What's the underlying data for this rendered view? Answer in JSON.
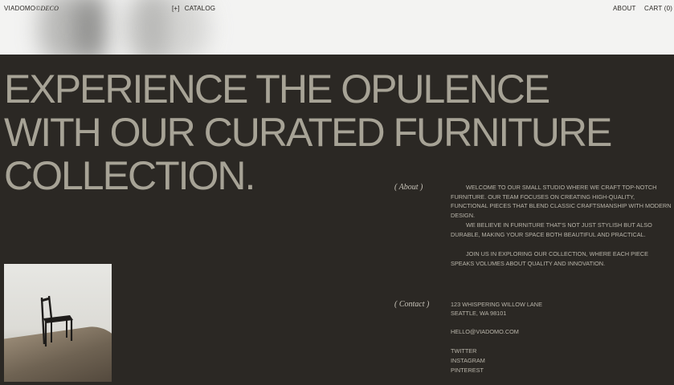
{
  "nav": {
    "logo_main": "VIADOMO",
    "logo_accent": "©DECO",
    "catalog_icon": "[+]",
    "catalog_label": "CATALOG",
    "about_label": "ABOUT",
    "cart_label": "CART (0)"
  },
  "hero": {
    "line1": "EXPERIENCE THE OPULENCE",
    "line2": "WITH OUR CURATED FURNITURE",
    "line3": "COLLECTION."
  },
  "about": {
    "label": "( About )",
    "paragraphs": [
      "WELCOME TO OUR SMALL STUDIO WHERE WE CRAFT TOP-NOTCH FURNITURE. OUR TEAM FOCUSES ON CREATING HIGH-QUALITY, FUNCTIONAL PIECES THAT BLEND CLASSIC CRAFTSMANSHIP WITH MODERN DESIGN.",
      "WE BELIEVE IN FURNITURE THAT'S NOT JUST STYLISH BUT ALSO DURABLE, MAKING YOUR SPACE BOTH BEAUTIFUL AND PRACTICAL.",
      "JOIN US IN EXPLORING OUR COLLECTION, WHERE EACH PIECE SPEAKS VOLUMES ABOUT QUALITY AND INNOVATION."
    ]
  },
  "contact": {
    "label": "( Contact )",
    "address1": "123 WHISPERING WILLOW LANE",
    "address2": "SEATTLE, WA 98101",
    "email": "HELLO@VIADOMO.COM",
    "socials": [
      "TWITTER",
      "INSTAGRAM",
      "PINTEREST"
    ]
  },
  "colors": {
    "background": "#2b2824",
    "headline": "#a7a396",
    "top_strip": "#f3f3f2"
  }
}
